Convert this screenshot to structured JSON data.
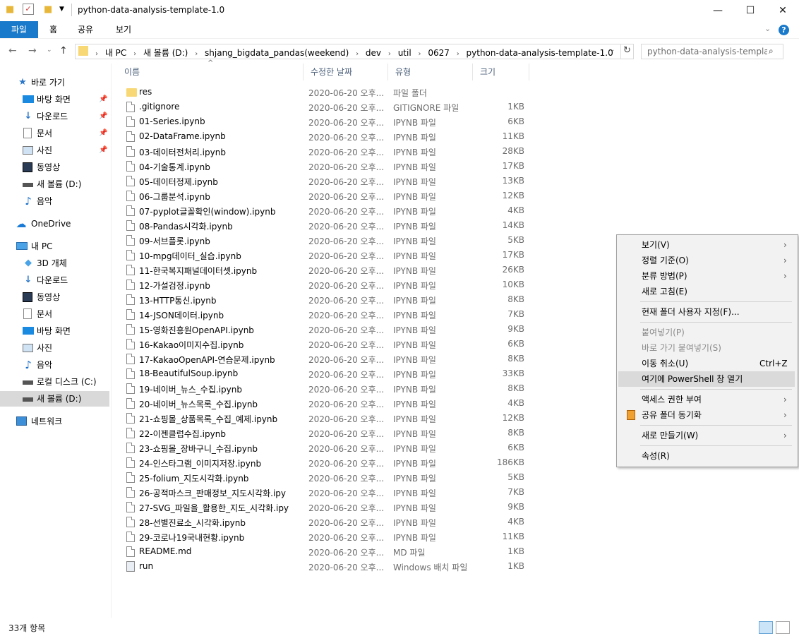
{
  "window": {
    "title": "python-data-analysis-template-1.0",
    "minimize_icon": "—",
    "maximize_icon": "☐",
    "close_icon": "✕"
  },
  "ribbon": {
    "tabs": [
      "파일",
      "홈",
      "공유",
      "보기"
    ]
  },
  "address": {
    "path": [
      "내 PC",
      "새 볼륨 (D:)",
      "shjang_bigdata_pandas(weekend)",
      "dev",
      "util",
      "0627",
      "python-data-analysis-template-1.0"
    ],
    "search_placeholder": "python-data-analysis-templa..."
  },
  "sidebar": {
    "quick_access": "바로 가기",
    "items": [
      {
        "label": "바탕 화면",
        "icon": "desktop-icon",
        "pinned": true
      },
      {
        "label": "다운로드",
        "icon": "download-icon",
        "pinned": true
      },
      {
        "label": "문서",
        "icon": "document-icon",
        "pinned": true
      },
      {
        "label": "사진",
        "icon": "picture-icon",
        "pinned": true
      },
      {
        "label": "동영상",
        "icon": "video-icon",
        "pinned": false
      },
      {
        "label": "새 볼륨 (D:)",
        "icon": "drive-icon",
        "pinned": false
      },
      {
        "label": "음악",
        "icon": "music-icon",
        "pinned": false
      }
    ],
    "onedrive": "OneDrive",
    "this_pc": "내 PC",
    "pc_items": [
      {
        "label": "3D 개체",
        "icon": "3d-objects-icon"
      },
      {
        "label": "다운로드",
        "icon": "download-icon"
      },
      {
        "label": "동영상",
        "icon": "video-icon"
      },
      {
        "label": "문서",
        "icon": "document-icon"
      },
      {
        "label": "바탕 화면",
        "icon": "desktop-icon"
      },
      {
        "label": "사진",
        "icon": "picture-icon"
      },
      {
        "label": "음악",
        "icon": "music-icon"
      },
      {
        "label": "로컬 디스크 (C:)",
        "icon": "drive-icon"
      },
      {
        "label": "새 볼륨 (D:)",
        "icon": "drive-icon",
        "selected": true
      }
    ],
    "network": "네트워크"
  },
  "columns": {
    "name": "이름",
    "date": "수정한 날짜",
    "type": "유형",
    "size": "크기"
  },
  "files": [
    {
      "name": "res",
      "date": "2020-06-20 오후...",
      "type": "파일 폴더",
      "size": "",
      "kind": "folder"
    },
    {
      "name": ".gitignore",
      "date": "2020-06-20 오후...",
      "type": "GITIGNORE 파일",
      "size": "1KB",
      "kind": "doc"
    },
    {
      "name": "01-Series.ipynb",
      "date": "2020-06-20 오후...",
      "type": "IPYNB 파일",
      "size": "6KB",
      "kind": "doc"
    },
    {
      "name": "02-DataFrame.ipynb",
      "date": "2020-06-20 오후...",
      "type": "IPYNB 파일",
      "size": "11KB",
      "kind": "doc"
    },
    {
      "name": "03-데이터전처리.ipynb",
      "date": "2020-06-20 오후...",
      "type": "IPYNB 파일",
      "size": "28KB",
      "kind": "doc"
    },
    {
      "name": "04-기술통계.ipynb",
      "date": "2020-06-20 오후...",
      "type": "IPYNB 파일",
      "size": "17KB",
      "kind": "doc"
    },
    {
      "name": "05-데이터정제.ipynb",
      "date": "2020-06-20 오후...",
      "type": "IPYNB 파일",
      "size": "13KB",
      "kind": "doc"
    },
    {
      "name": "06-그룹분석.ipynb",
      "date": "2020-06-20 오후...",
      "type": "IPYNB 파일",
      "size": "12KB",
      "kind": "doc"
    },
    {
      "name": "07-pyplot글꼴확인(window).ipynb",
      "date": "2020-06-20 오후...",
      "type": "IPYNB 파일",
      "size": "4KB",
      "kind": "doc"
    },
    {
      "name": "08-Pandas시각화.ipynb",
      "date": "2020-06-20 오후...",
      "type": "IPYNB 파일",
      "size": "14KB",
      "kind": "doc"
    },
    {
      "name": "09-서브플롯.ipynb",
      "date": "2020-06-20 오후...",
      "type": "IPYNB 파일",
      "size": "5KB",
      "kind": "doc"
    },
    {
      "name": "10-mpg데이터_실습.ipynb",
      "date": "2020-06-20 오후...",
      "type": "IPYNB 파일",
      "size": "17KB",
      "kind": "doc"
    },
    {
      "name": "11-한국복지패널데이터셋.ipynb",
      "date": "2020-06-20 오후...",
      "type": "IPYNB 파일",
      "size": "26KB",
      "kind": "doc"
    },
    {
      "name": "12-가설검정.ipynb",
      "date": "2020-06-20 오후...",
      "type": "IPYNB 파일",
      "size": "10KB",
      "kind": "doc"
    },
    {
      "name": "13-HTTP통신.ipynb",
      "date": "2020-06-20 오후...",
      "type": "IPYNB 파일",
      "size": "8KB",
      "kind": "doc"
    },
    {
      "name": "14-JSON데이터.ipynb",
      "date": "2020-06-20 오후...",
      "type": "IPYNB 파일",
      "size": "7KB",
      "kind": "doc"
    },
    {
      "name": "15-영화진흥원OpenAPI.ipynb",
      "date": "2020-06-20 오후...",
      "type": "IPYNB 파일",
      "size": "9KB",
      "kind": "doc"
    },
    {
      "name": "16-Kakao이미지수집.ipynb",
      "date": "2020-06-20 오후...",
      "type": "IPYNB 파일",
      "size": "6KB",
      "kind": "doc"
    },
    {
      "name": "17-KakaoOpenAPI-연습문제.ipynb",
      "date": "2020-06-20 오후...",
      "type": "IPYNB 파일",
      "size": "8KB",
      "kind": "doc"
    },
    {
      "name": "18-BeautifulSoup.ipynb",
      "date": "2020-06-20 오후...",
      "type": "IPYNB 파일",
      "size": "33KB",
      "kind": "doc"
    },
    {
      "name": "19-네이버_뉴스_수집.ipynb",
      "date": "2020-06-20 오후...",
      "type": "IPYNB 파일",
      "size": "8KB",
      "kind": "doc"
    },
    {
      "name": "20-네이버_뉴스목록_수집.ipynb",
      "date": "2020-06-20 오후...",
      "type": "IPYNB 파일",
      "size": "4KB",
      "kind": "doc"
    },
    {
      "name": "21-쇼핑몰_상품목록_수집_예제.ipynb",
      "date": "2020-06-20 오후...",
      "type": "IPYNB 파일",
      "size": "12KB",
      "kind": "doc"
    },
    {
      "name": "22-이젠클럽수집.ipynb",
      "date": "2020-06-20 오후...",
      "type": "IPYNB 파일",
      "size": "8KB",
      "kind": "doc"
    },
    {
      "name": "23-쇼핑몰_장바구니_수집.ipynb",
      "date": "2020-06-20 오후...",
      "type": "IPYNB 파일",
      "size": "6KB",
      "kind": "doc"
    },
    {
      "name": "24-인스타그램_이미지저장.ipynb",
      "date": "2020-06-20 오후...",
      "type": "IPYNB 파일",
      "size": "186KB",
      "kind": "doc"
    },
    {
      "name": "25-folium_지도시각화.ipynb",
      "date": "2020-06-20 오후...",
      "type": "IPYNB 파일",
      "size": "5KB",
      "kind": "doc"
    },
    {
      "name": "26-공적마스크_판매정보_지도시각화.ipy",
      "date": "2020-06-20 오후...",
      "type": "IPYNB 파일",
      "size": "7KB",
      "kind": "doc"
    },
    {
      "name": "27-SVG_파일을_활용한_지도_시각화.ipy",
      "date": "2020-06-20 오후...",
      "type": "IPYNB 파일",
      "size": "9KB",
      "kind": "doc"
    },
    {
      "name": "28-선별진료소_시각화.ipynb",
      "date": "2020-06-20 오후...",
      "type": "IPYNB 파일",
      "size": "4KB",
      "kind": "doc"
    },
    {
      "name": "29-코로나19국내현황.ipynb",
      "date": "2020-06-20 오후...",
      "type": "IPYNB 파일",
      "size": "11KB",
      "kind": "doc"
    },
    {
      "name": "README.md",
      "date": "2020-06-20 오후...",
      "type": "MD 파일",
      "size": "1KB",
      "kind": "doc"
    },
    {
      "name": "run",
      "date": "2020-06-20 오후...",
      "type": "Windows 배치 파일",
      "size": "1KB",
      "kind": "bat"
    }
  ],
  "status": {
    "count": "33개 항목"
  },
  "context_menu": {
    "items": [
      {
        "label": "보기(V)",
        "submenu": true
      },
      {
        "label": "정렬 기준(O)",
        "submenu": true
      },
      {
        "label": "분류 방법(P)",
        "submenu": true
      },
      {
        "label": "새로 고침(E)"
      },
      {
        "separator": true
      },
      {
        "label": "현재 폴더 사용자 지정(F)..."
      },
      {
        "separator": true
      },
      {
        "label": "붙여넣기(P)",
        "disabled": true
      },
      {
        "label": "바로 가기 붙여넣기(S)",
        "disabled": true
      },
      {
        "label": "이동 취소(U)",
        "shortcut": "Ctrl+Z"
      },
      {
        "label": "여기에 PowerShell 창 열기",
        "highlighted": true
      },
      {
        "separator": true
      },
      {
        "label": "액세스 권한 부여",
        "submenu": true
      },
      {
        "label": "공유 폴더 동기화",
        "submenu": true,
        "icon": true
      },
      {
        "separator": true
      },
      {
        "label": "새로 만들기(W)",
        "submenu": true
      },
      {
        "separator": true
      },
      {
        "label": "속성(R)"
      }
    ]
  }
}
